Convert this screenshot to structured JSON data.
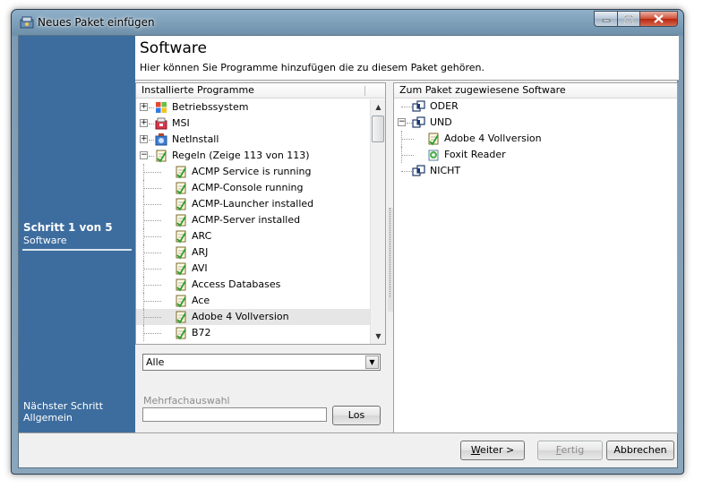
{
  "window": {
    "title": "Neues Paket einfügen"
  },
  "wizard": {
    "step_title": "Schritt 1 von 5",
    "step_name": "Software",
    "next_label": "Nächster Schritt",
    "next_name": "Allgemein"
  },
  "header": {
    "title": "Software",
    "subtitle": "Hier können Sie Programme hinzufügen die zu diesem Paket gehören."
  },
  "installed": {
    "column_header": "Installierte Programme",
    "items": [
      {
        "label": "Betriebssystem",
        "level": 0,
        "expander": "+",
        "icon": "windows-icon"
      },
      {
        "label": "MSI",
        "level": 0,
        "expander": "+",
        "icon": "msi-package-icon"
      },
      {
        "label": "NetInstall",
        "level": 0,
        "expander": "+",
        "icon": "netinstall-icon"
      },
      {
        "label": "Regeln (Zeige 113 von 113)",
        "level": 0,
        "expander": "-",
        "icon": "rule-icon"
      },
      {
        "label": "ACMP Service is running",
        "level": 1,
        "icon": "rule-icon"
      },
      {
        "label": "ACMP-Console running",
        "level": 1,
        "icon": "rule-icon"
      },
      {
        "label": "ACMP-Launcher installed",
        "level": 1,
        "icon": "rule-icon"
      },
      {
        "label": "ACMP-Server installed",
        "level": 1,
        "icon": "rule-icon"
      },
      {
        "label": "ARC",
        "level": 1,
        "icon": "rule-icon"
      },
      {
        "label": "ARJ",
        "level": 1,
        "icon": "rule-icon"
      },
      {
        "label": "AVI",
        "level": 1,
        "icon": "rule-icon"
      },
      {
        "label": "Access Databases",
        "level": 1,
        "icon": "rule-icon"
      },
      {
        "label": "Ace",
        "level": 1,
        "icon": "rule-icon"
      },
      {
        "label": "Adobe 4 Vollversion",
        "level": 1,
        "icon": "rule-icon",
        "selected": true
      },
      {
        "label": "B72",
        "level": 1,
        "icon": "rule-icon"
      }
    ]
  },
  "filter": {
    "selected": "Alle"
  },
  "multi": {
    "label": "Mehrfachauswahl",
    "value": "",
    "button": "Los"
  },
  "assigned": {
    "column_header": "Zum Paket zugewiesene Software",
    "items": [
      {
        "label": "ODER",
        "level": 0,
        "icon": "logic-group-icon"
      },
      {
        "label": "UND",
        "level": 0,
        "icon": "logic-group-icon",
        "expander": "-"
      },
      {
        "label": "Adobe 4 Vollversion",
        "level": 1,
        "icon": "rule-icon"
      },
      {
        "label": "Foxit Reader",
        "level": 1,
        "icon": "software-package-icon"
      },
      {
        "label": "NICHT",
        "level": 0,
        "icon": "logic-group-icon"
      }
    ]
  },
  "buttons": {
    "next_prefix": "W",
    "next_rest": "eiter >",
    "finish_prefix": "F",
    "finish_rest": "ertig",
    "cancel": "Abbrechen"
  }
}
